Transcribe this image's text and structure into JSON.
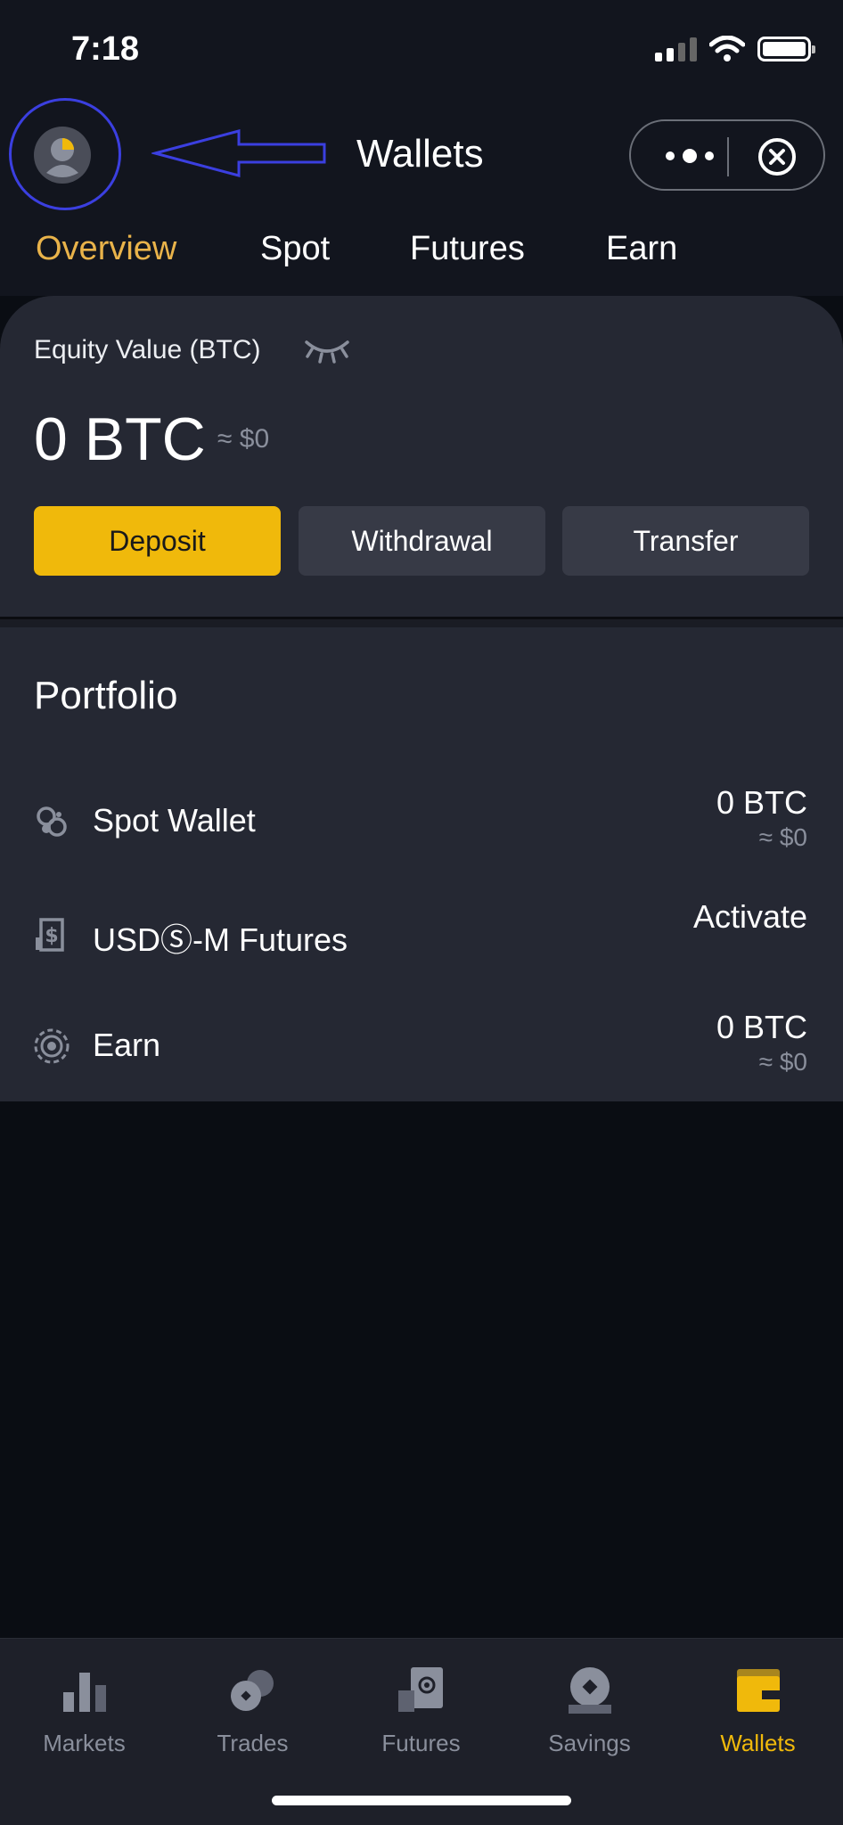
{
  "status_bar": {
    "time": "7:18"
  },
  "header": {
    "title": "Wallets"
  },
  "tabs": [
    {
      "label": "Overview",
      "active": true
    },
    {
      "label": "Spot",
      "active": false
    },
    {
      "label": "Futures",
      "active": false
    },
    {
      "label": "Earn",
      "active": false
    }
  ],
  "balance": {
    "label": "Equity Value (BTC)",
    "value": "0 BTC",
    "usd": "≈ $0",
    "buttons": {
      "deposit": "Deposit",
      "withdrawal": "Withdrawal",
      "transfer": "Transfer"
    }
  },
  "portfolio": {
    "title": "Portfolio",
    "rows": [
      {
        "icon": "spot-wallet-icon",
        "label": "Spot Wallet",
        "value": "0 BTC",
        "sub": "≈ $0"
      },
      {
        "icon": "futures-dollar-icon",
        "label": "USDⓈ-M Futures",
        "value": "Activate",
        "sub": ""
      },
      {
        "icon": "earn-target-icon",
        "label": "Earn",
        "value": "0 BTC",
        "sub": "≈ $0"
      }
    ]
  },
  "bottom_nav": [
    {
      "label": "Markets",
      "icon": "markets-icon",
      "active": false
    },
    {
      "label": "Trades",
      "icon": "trades-icon",
      "active": false
    },
    {
      "label": "Futures",
      "icon": "futures-icon",
      "active": false
    },
    {
      "label": "Savings",
      "icon": "savings-icon",
      "active": false
    },
    {
      "label": "Wallets",
      "icon": "wallets-icon",
      "active": true
    }
  ],
  "colors": {
    "accent": "#f0b90b",
    "active_tab": "#e9b34a",
    "annotation": "#3b3fe0",
    "card": "#252833",
    "background": "#0a0d13"
  }
}
